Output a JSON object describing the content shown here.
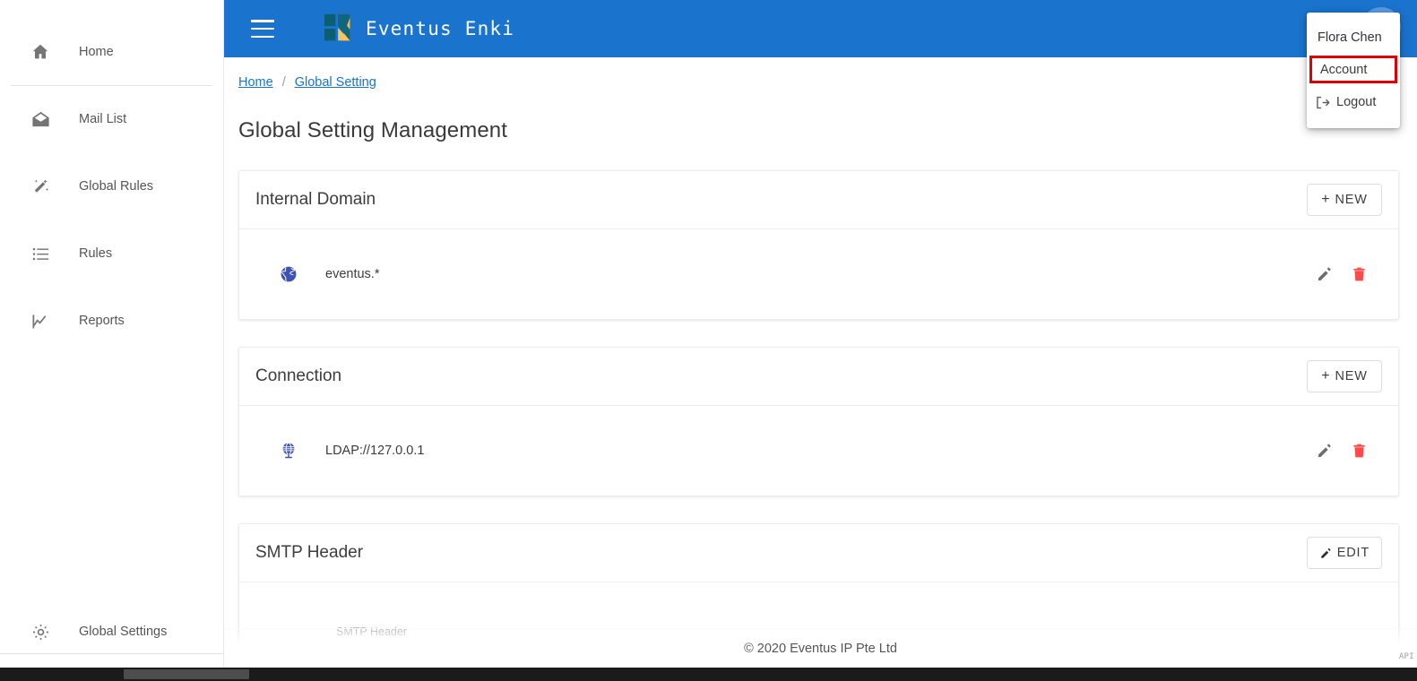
{
  "app": {
    "brand_name": "Eventus Enki",
    "accent_color": "#1a73cc",
    "highlight_color": "#e00000",
    "icon_color": "#3f51b5",
    "danger_color": "#fb4a4a"
  },
  "topbar": {
    "menu_icon": "hamburger-icon",
    "logo_icon": "eventus-enki-logo",
    "avatar_icon": "user-avatar-icon"
  },
  "user_menu": {
    "user_name": "Flora Chen",
    "account_label": "Account",
    "logout_label": "Logout",
    "logout_icon": "logout-icon",
    "highlighted_item": "Account"
  },
  "sidebar": {
    "items": [
      {
        "label": "Home",
        "icon": "home-icon"
      },
      {
        "label": "Mail List",
        "icon": "mail-icon"
      },
      {
        "label": "Global Rules",
        "icon": "magic-wand-icon"
      },
      {
        "label": "Rules",
        "icon": "list-icon"
      },
      {
        "label": "Reports",
        "icon": "chart-line-icon"
      }
    ],
    "bottom_item": {
      "label": "Global Settings",
      "icon": "gear-icon"
    }
  },
  "breadcrumb": {
    "home": "Home",
    "separator": "/",
    "current": "Global Setting"
  },
  "page": {
    "title": "Global Setting Management"
  },
  "cards": [
    {
      "title": "Internal Domain",
      "action_label": "+ NEW",
      "action_plus": "+",
      "action_text": "NEW",
      "action_icon": "plus-icon",
      "row": {
        "icon": "globe-americas-icon",
        "text": "eventus.*",
        "edit_icon": "pencil-icon",
        "delete_icon": "trash-icon"
      }
    },
    {
      "title": "Connection",
      "action_label": "+ NEW",
      "action_plus": "+",
      "action_text": "NEW",
      "action_icon": "plus-icon",
      "row": {
        "icon": "network-globe-icon",
        "text": "LDAP://127.0.0.1",
        "edit_icon": "pencil-icon",
        "delete_icon": "trash-icon"
      }
    },
    {
      "title": "SMTP Header",
      "action_text": "EDIT",
      "action_icon": "pencil-icon",
      "field_label": "SMTP Header"
    }
  ],
  "footer": {
    "copyright": "© 2020 Eventus IP Pte Ltd",
    "api_tag": "API"
  }
}
